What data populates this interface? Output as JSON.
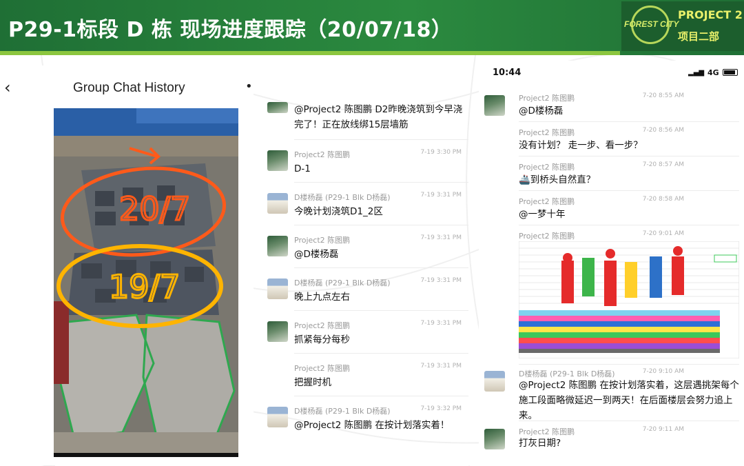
{
  "header": {
    "title": "P29-1标段 D 栋 现场进度跟踪（20/07/18）",
    "logo_brand": "FOREST CITY",
    "logo_project": "PROJECT 2",
    "logo_dept": "项目二部"
  },
  "colors": {
    "header_green": "#2b8a3f",
    "stripe": "#8cc63f",
    "logo_text": "#e9f06a"
  },
  "panel1": {
    "back_icon": "chevron-left-icon",
    "title": "Group Chat History",
    "more_icon": "dot-menu-icon",
    "photo_annotations": [
      "20/7",
      "19/7"
    ]
  },
  "panel2": {
    "messages": [
      {
        "sender": "",
        "time": "",
        "text": "@Project2 陈图鹏 D2昨晚浇筑到今早浇完了！正在放线绑15层墙筋",
        "avatar": "green"
      },
      {
        "sender": "Project2 陈图鹏",
        "time": "7-19 3:30 PM",
        "text": "D-1",
        "avatar": "green"
      },
      {
        "sender": "D楼杨磊 (P29-1 Blk D杨磊)",
        "time": "7-19 3:31 PM",
        "text": "今晚计划浇筑D1_2区",
        "avatar": "building"
      },
      {
        "sender": "Project2 陈图鹏",
        "time": "7-19 3:31 PM",
        "text": "@D楼杨磊",
        "avatar": "green"
      },
      {
        "sender": "D楼杨磊 (P29-1 Blk D杨磊)",
        "time": "7-19 3:31 PM",
        "text": "晚上九点左右",
        "avatar": "building"
      },
      {
        "sender": "Project2 陈图鹏",
        "time": "7-19 3:31 PM",
        "text": "抓紧每分每秒",
        "avatar": "green"
      },
      {
        "sender": "Project2 陈图鹏",
        "time": "7-19 3:31 PM",
        "text": "把握时机",
        "avatar": "none"
      },
      {
        "sender": "D楼杨磊 (P29-1 Blk D杨磊)",
        "time": "7-19 3:32 PM",
        "text": "@Project2 陈图鹏 在按计划落实着！",
        "avatar": "building"
      }
    ]
  },
  "panel3": {
    "status": {
      "time": "10:44",
      "network": "4G"
    },
    "messages": [
      {
        "sender": "Project2 陈图鹏",
        "time": "7-20 8:55 AM",
        "text": "@D楼杨磊",
        "avatar": "green"
      },
      {
        "sender": "Project2 陈图鹏",
        "time": "7-20 8:56 AM",
        "text": "没有计划？ 走一步、看一步？",
        "avatar": "none"
      },
      {
        "sender": "Project2 陈图鹏",
        "time": "7-20 8:57 AM",
        "text": "🚢到桥头自然直？",
        "avatar": "none"
      },
      {
        "sender": "Project2 陈图鹏",
        "time": "7-20 8:58 AM",
        "text": "@一梦十年",
        "avatar": "none"
      },
      {
        "sender": "Project2 陈图鹏",
        "time": "7-20 9:01 AM",
        "text": "",
        "avatar": "none"
      },
      {
        "sender": "D楼杨磊 (P29-1 Blk D杨磊)",
        "time": "7-20 9:10 AM",
        "text": "@Project2 陈图鹏 在按计划落实着，这层遇挑架每个施工段面略微延迟一到两天！在后面楼层会努力追上来。",
        "avatar": "building"
      },
      {
        "sender": "Project2 陈图鹏",
        "time": "7-20 9:11 AM",
        "text": "打灰日期?",
        "avatar": "green"
      }
    ]
  }
}
